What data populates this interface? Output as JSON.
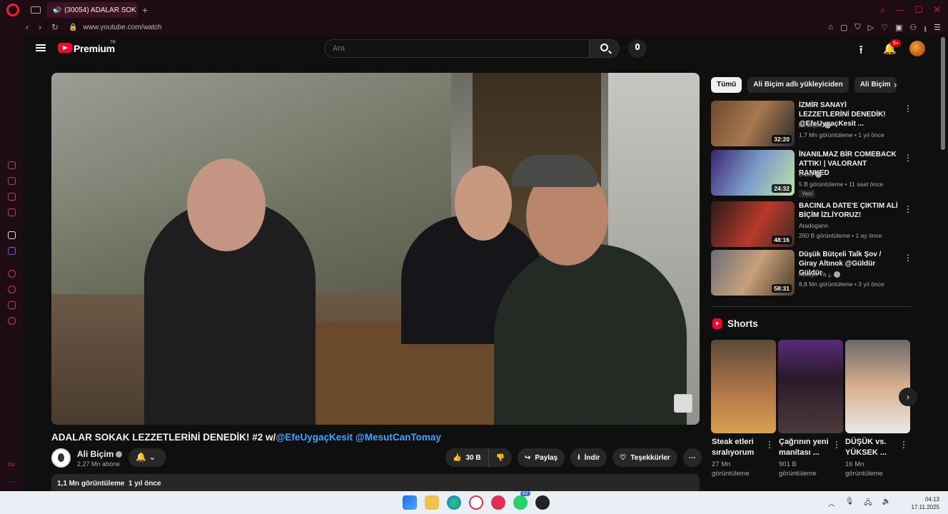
{
  "browser": {
    "tab_title": "(30054) ADALAR SOK",
    "new_tab": "+",
    "url": "www.youtube.com/watch"
  },
  "header": {
    "brand": "Premium",
    "region": "TR",
    "search_placeholder": "Ara",
    "notifications_badge": "9+"
  },
  "video": {
    "title_text": "ADALAR SOKAK LEZZETLERİNİ DENEDİK! #2 w/",
    "title_link1": "@EfeUygaçKesit",
    "title_link2": "@MesutCanTomay",
    "channel": "Ali Biçim",
    "subscribers": "2,27 Mn abone",
    "likes": "30 B",
    "share": "Paylaş",
    "download": "İndir",
    "thanks": "Teşekkürler",
    "more": "⋯",
    "views": "1,1 Mn görüntüleme",
    "ago": "1 yıl önce"
  },
  "chips": [
    "Tümü",
    "Ali Biçim adlı yükleyiciden",
    "Ali Biçim"
  ],
  "recommendations": [
    {
      "title": "İZMİR SANAYİ LEZZETLERİNİ DENEDİK! @EfeUygaçKesit ...",
      "channel": "Ali Biçim",
      "meta": "1,7 Mn görüntüleme • 1 yıl önce",
      "duration": "32:20",
      "badge": ""
    },
    {
      "title": "İNANILMAZ BİR COMEBACK ATTIK! | VALORANT RANKED",
      "channel": "cNed",
      "meta": "5 B görüntüleme • 11 saat önce",
      "duration": "24:32",
      "badge": "Yeni"
    },
    {
      "title": "BACINLA DATE'E ÇIKTIM ALİ BİÇİM İZLİYORUZ!",
      "channel": "Atadogann",
      "meta": "260 B görüntüleme • 1 ay önce",
      "duration": "48:16",
      "badge": ""
    },
    {
      "title": "Düşük Bütçeli Talk Şov / Giray Altınok @Güldür Güldür",
      "channel": "Noluyo Ya ¿",
      "meta": "8,8 Mn görüntüleme • 3 yıl önce",
      "duration": "58:31",
      "badge": ""
    }
  ],
  "shorts": {
    "heading": "Shorts",
    "items": [
      {
        "title": "Steak etleri sıralıyorum",
        "views": "27 Mn görüntüleme"
      },
      {
        "title": "Çağrının yeni manitası ...",
        "views": "901 B görüntüleme"
      },
      {
        "title": "DÜŞÜK vs. YÜKSEK ...",
        "views": "16 Mn görüntüleme"
      }
    ]
  },
  "taskbar": {
    "whatsapp_badge": "82",
    "time": "04:13",
    "date": "17.11.2025"
  }
}
